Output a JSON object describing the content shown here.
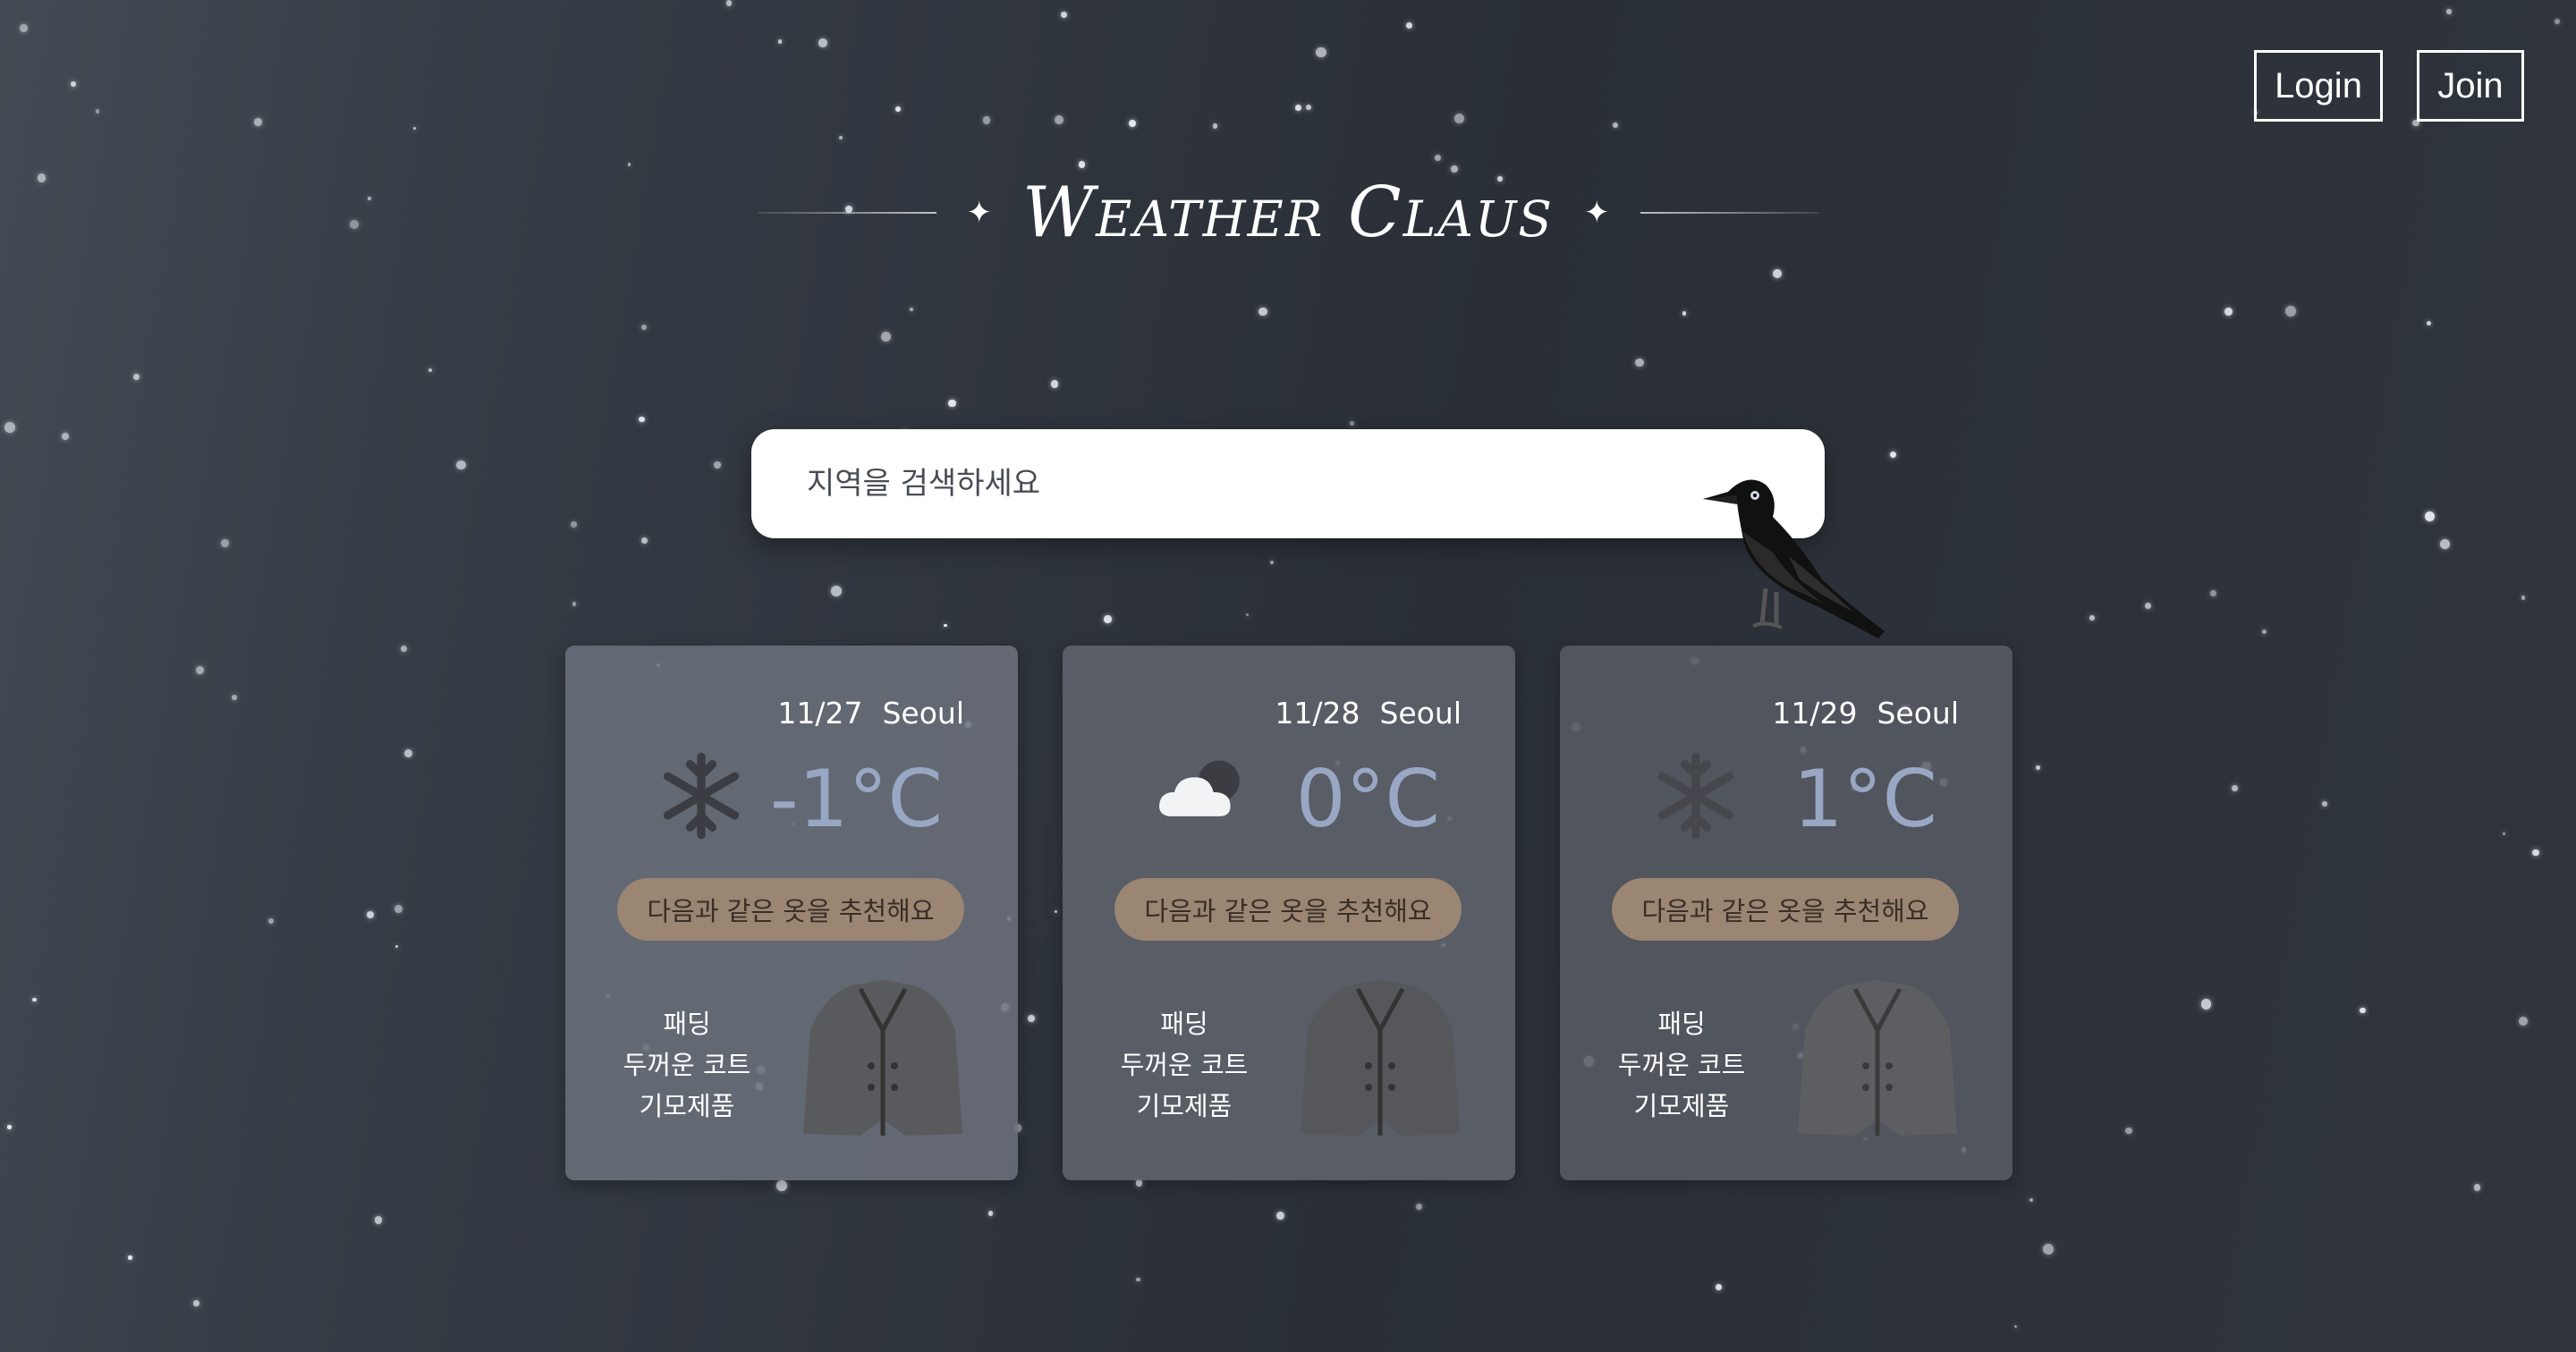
{
  "header": {
    "login_label": "Login",
    "join_label": "Join"
  },
  "logo": {
    "title": "Weather Claus"
  },
  "search": {
    "placeholder": "지역을 검색하세요"
  },
  "cards": [
    {
      "date": "11/27",
      "city": "Seoul",
      "temp": "-1°C",
      "icon": "snowflake-icon",
      "recommend": "다음과 같은 옷을 추천해요",
      "clothes": [
        "패딩",
        "두꺼운 코트",
        "기모제품"
      ]
    },
    {
      "date": "11/28",
      "city": "Seoul",
      "temp": "0°C",
      "icon": "cloud-rain-icon",
      "recommend": "다음과 같은 옷을 추천해요",
      "clothes": [
        "패딩",
        "두꺼운 코트",
        "기모제품"
      ]
    },
    {
      "date": "11/29",
      "city": "Seoul",
      "temp": "1°C",
      "icon": "snowflake-icon",
      "recommend": "다음과 같은 옷을 추천해요",
      "clothes": [
        "패딩",
        "두꺼운 코트",
        "기모제품"
      ]
    }
  ],
  "colors": {
    "temp": "#9aa7c4",
    "recommend_bg": "#9b8573",
    "search_bg": "#ffffff"
  }
}
